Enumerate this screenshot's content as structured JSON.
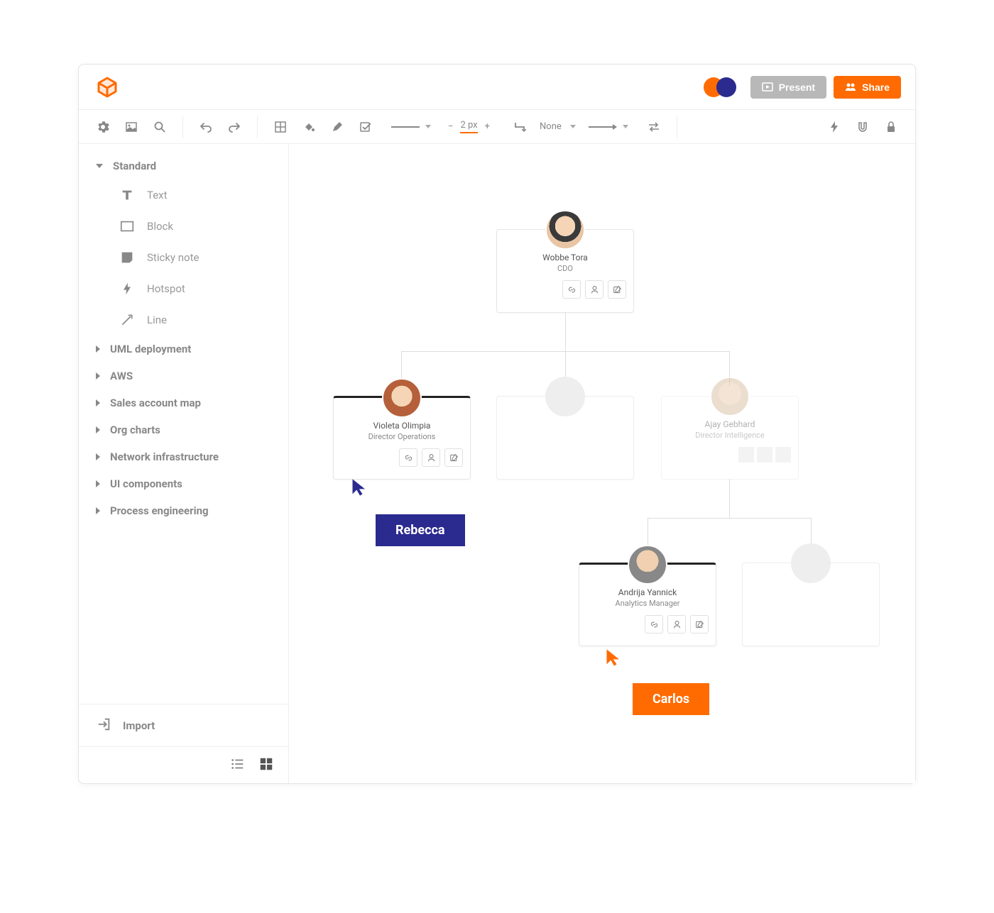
{
  "header": {
    "present_label": "Present",
    "share_label": "Share"
  },
  "toolbar": {
    "stroke_width": "2 px",
    "line_end": "None"
  },
  "sidebar": {
    "categories": [
      {
        "label": "Standard",
        "open": true
      },
      {
        "label": "UML deployment",
        "open": false
      },
      {
        "label": "AWS",
        "open": false
      },
      {
        "label": "Sales account map",
        "open": false
      },
      {
        "label": "Org charts",
        "open": false
      },
      {
        "label": "Network infrastructure",
        "open": false
      },
      {
        "label": "UI components",
        "open": false
      },
      {
        "label": "Process engineering",
        "open": false
      }
    ],
    "standard_shapes": [
      {
        "label": "Text"
      },
      {
        "label": "Block"
      },
      {
        "label": "Sticky note"
      },
      {
        "label": "Hotspot"
      },
      {
        "label": "Line"
      }
    ],
    "import_label": "Import"
  },
  "org": {
    "root": {
      "name": "Wobbe Tora",
      "title": "CDO"
    },
    "left": {
      "name": "Violeta Olimpia",
      "title": "Director Operations"
    },
    "right": {
      "name": "Ajay Gebhard",
      "title": "Director Intelligence"
    },
    "child": {
      "name": "Andrija Yannick",
      "title": "Analytics Manager"
    }
  },
  "cursors": {
    "rebecca": "Rebecca",
    "carlos": "Carlos"
  },
  "colors": {
    "accent": "#ff6b00",
    "cursor_blue": "#2a2a8f"
  }
}
